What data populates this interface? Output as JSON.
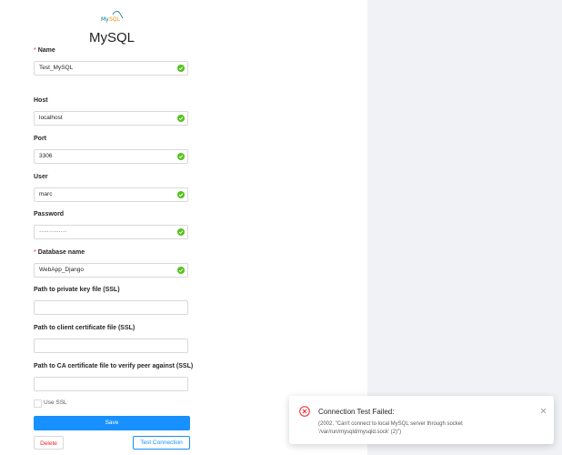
{
  "logo": {
    "icon": "mysql-logo-icon"
  },
  "title": "MySQL",
  "form": {
    "name": {
      "label": "Name",
      "required": true,
      "value": "Test_MySQL",
      "valid": true
    },
    "host": {
      "label": "Host",
      "value": "localhost",
      "valid": true
    },
    "port": {
      "label": "Port",
      "value": "3306",
      "valid": true
    },
    "user": {
      "label": "User",
      "value": "marc",
      "valid": true
    },
    "password": {
      "label": "Password",
      "value": "··············",
      "valid": true
    },
    "database": {
      "label": "Database name",
      "required": true,
      "value": "WebApp_Django",
      "valid": true
    },
    "ssl_key": {
      "label": "Path to private key file (SSL)",
      "value": ""
    },
    "ssl_cert": {
      "label": "Path to client certificate file (SSL)",
      "value": ""
    },
    "ssl_ca": {
      "label": "Path to CA certificate file to verify peer against (SSL)",
      "value": ""
    },
    "use_ssl": {
      "label": "Use SSL",
      "checked": false
    }
  },
  "buttons": {
    "save": "Save",
    "delete": "Delete",
    "test": "Test Connection"
  },
  "notification": {
    "title": "Connection Test Failed:",
    "message": "(2002, \"Can't connect to local MySQL server through socket '/var/run/mysqld/mysqld.sock' (2)\")",
    "icon": "error-circle-icon"
  },
  "colors": {
    "primary": "#1890ff",
    "success": "#52c41a",
    "error": "#f5222d",
    "panel_bg": "#f0f2f5"
  }
}
